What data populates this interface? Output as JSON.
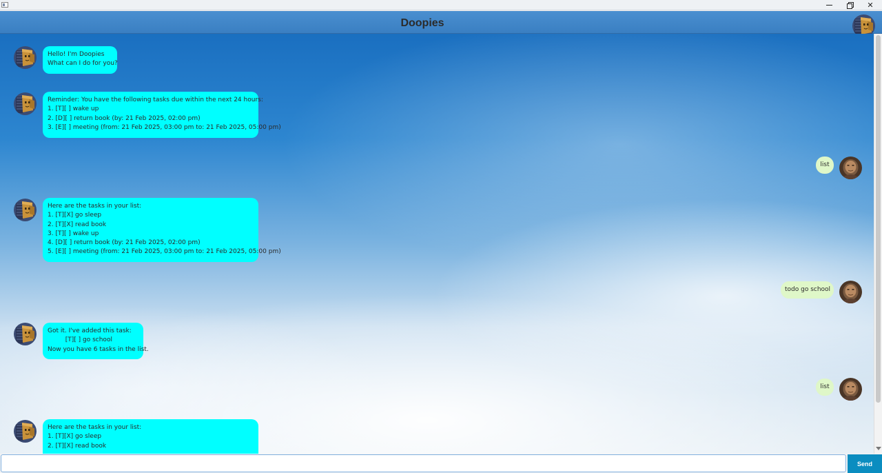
{
  "window": {
    "minimize_glyph": "minimize",
    "maximize_glyph": "restore",
    "close_glyph": "✕"
  },
  "header": {
    "title": "Doopies"
  },
  "messages": [
    {
      "from": "bot",
      "text": "Hello! I'm Doopies\nWhat can I do for you?"
    },
    {
      "from": "bot",
      "text": "Reminder: You have the following tasks due within the next 24 hours:\n1. [T][ ] wake up\n2. [D][ ] return book (by: 21 Feb 2025, 02:00 pm)\n3. [E][ ] meeting (from: 21 Feb 2025, 03:00 pm to: 21 Feb 2025, 05:00 pm)"
    },
    {
      "from": "user",
      "text": "list"
    },
    {
      "from": "bot",
      "text": "Here are the tasks in your list:\n1. [T][X] go sleep\n2. [T][X] read book\n3. [T][ ] wake up\n4. [D][ ] return book (by: 21 Feb 2025, 02:00 pm)\n5. [E][ ] meeting (from: 21 Feb 2025, 03:00 pm to: 21 Feb 2025, 05:00 pm)"
    },
    {
      "from": "user",
      "text": "todo go school"
    },
    {
      "from": "bot",
      "text": "Got it. I've added this task:\n         [T][ ] go school\nNow you have 6 tasks in the list."
    },
    {
      "from": "user",
      "text": "list"
    },
    {
      "from": "bot",
      "text": "Here are the tasks in your list:\n1. [T][X] go sleep\n2. [T][X] read book"
    }
  ],
  "input": {
    "value": "",
    "placeholder": ""
  },
  "send_button": {
    "label": "Send"
  },
  "colors": {
    "bot_bubble": "#00ffff",
    "user_bubble": "#dff7c8",
    "header": "#3a7fc2",
    "send_button": "#0b8dc0"
  },
  "icons": {
    "bot_avatar": "cardboard-box-robot-icon",
    "user_avatar": "user-portrait-icon"
  }
}
